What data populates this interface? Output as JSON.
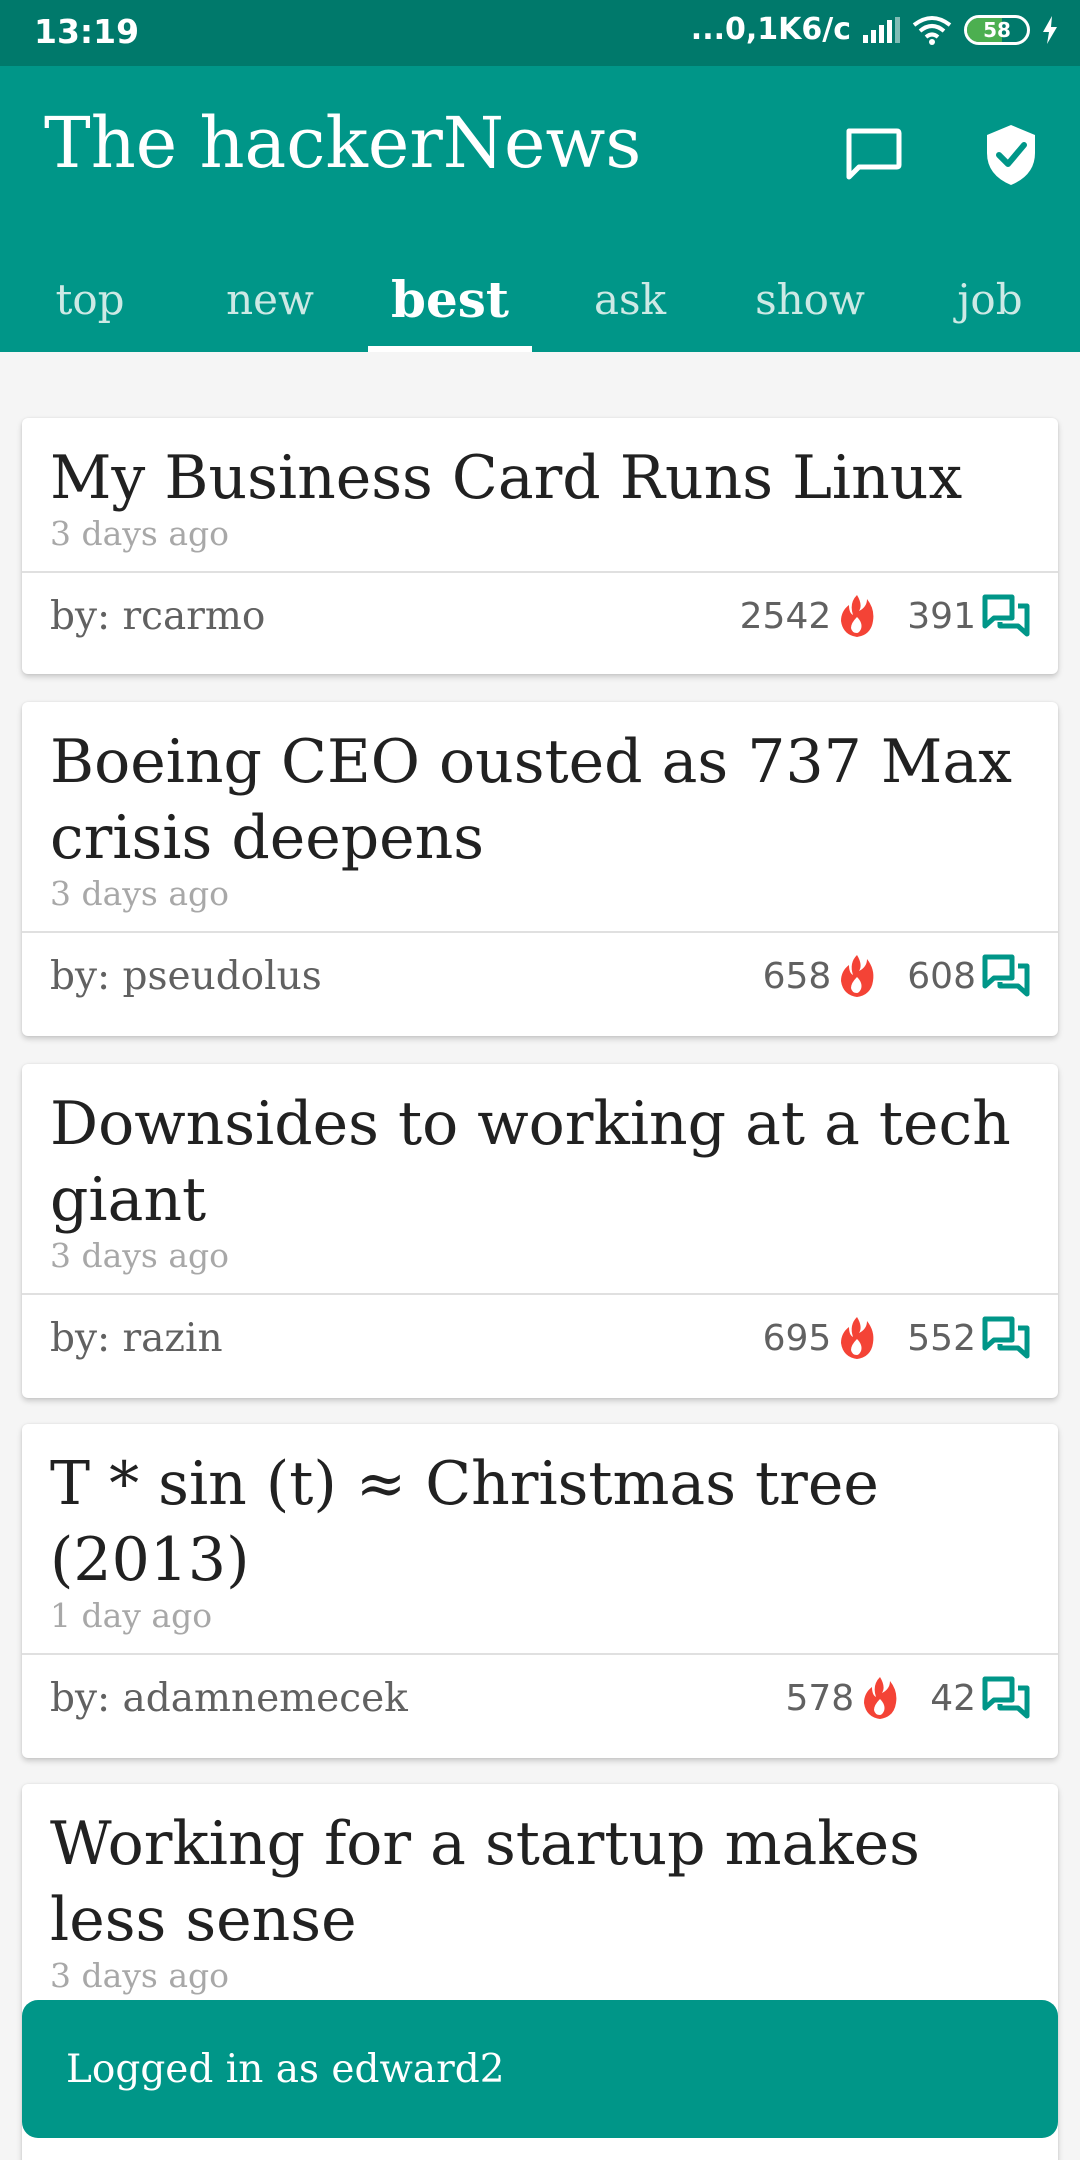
{
  "status_bar": {
    "time": "13:19",
    "network_speed": "...0,1K6/c",
    "battery_level": "58"
  },
  "app": {
    "title": "The hackerNews",
    "icons": [
      "chat-icon",
      "shield-check-icon"
    ]
  },
  "tabs": [
    {
      "label": "top",
      "active": false
    },
    {
      "label": "new",
      "active": false
    },
    {
      "label": "best",
      "active": true
    },
    {
      "label": "ask",
      "active": false
    },
    {
      "label": "show",
      "active": false
    },
    {
      "label": "job",
      "active": false
    }
  ],
  "stories": [
    {
      "title": "My Business Card Runs Linux",
      "time": "3 days ago",
      "by": "by: rcarmo",
      "points": "2542",
      "comments": "391"
    },
    {
      "title": "Boeing CEO ousted as 737 Max crisis deepens",
      "time": "3 days ago",
      "by": "by: pseudolus",
      "points": "658",
      "comments": "608"
    },
    {
      "title": "Downsides to working at a tech giant",
      "time": "3 days ago",
      "by": "by: razin",
      "points": "695",
      "comments": "552"
    },
    {
      "title": "T * sin (t) ≈ Christmas tree (2013)",
      "time": "1 day ago",
      "by": "by: adamnemecek",
      "points": "578",
      "comments": "42"
    },
    {
      "title": "Working for a startup makes less sense",
      "time": "3 days ago"
    }
  ],
  "snackbar": {
    "text": "Logged in as edward2"
  },
  "colors": {
    "primary": "#009688",
    "status_bar": "#00796b",
    "points_icon": "#f44336",
    "comments_icon": "#009688"
  }
}
